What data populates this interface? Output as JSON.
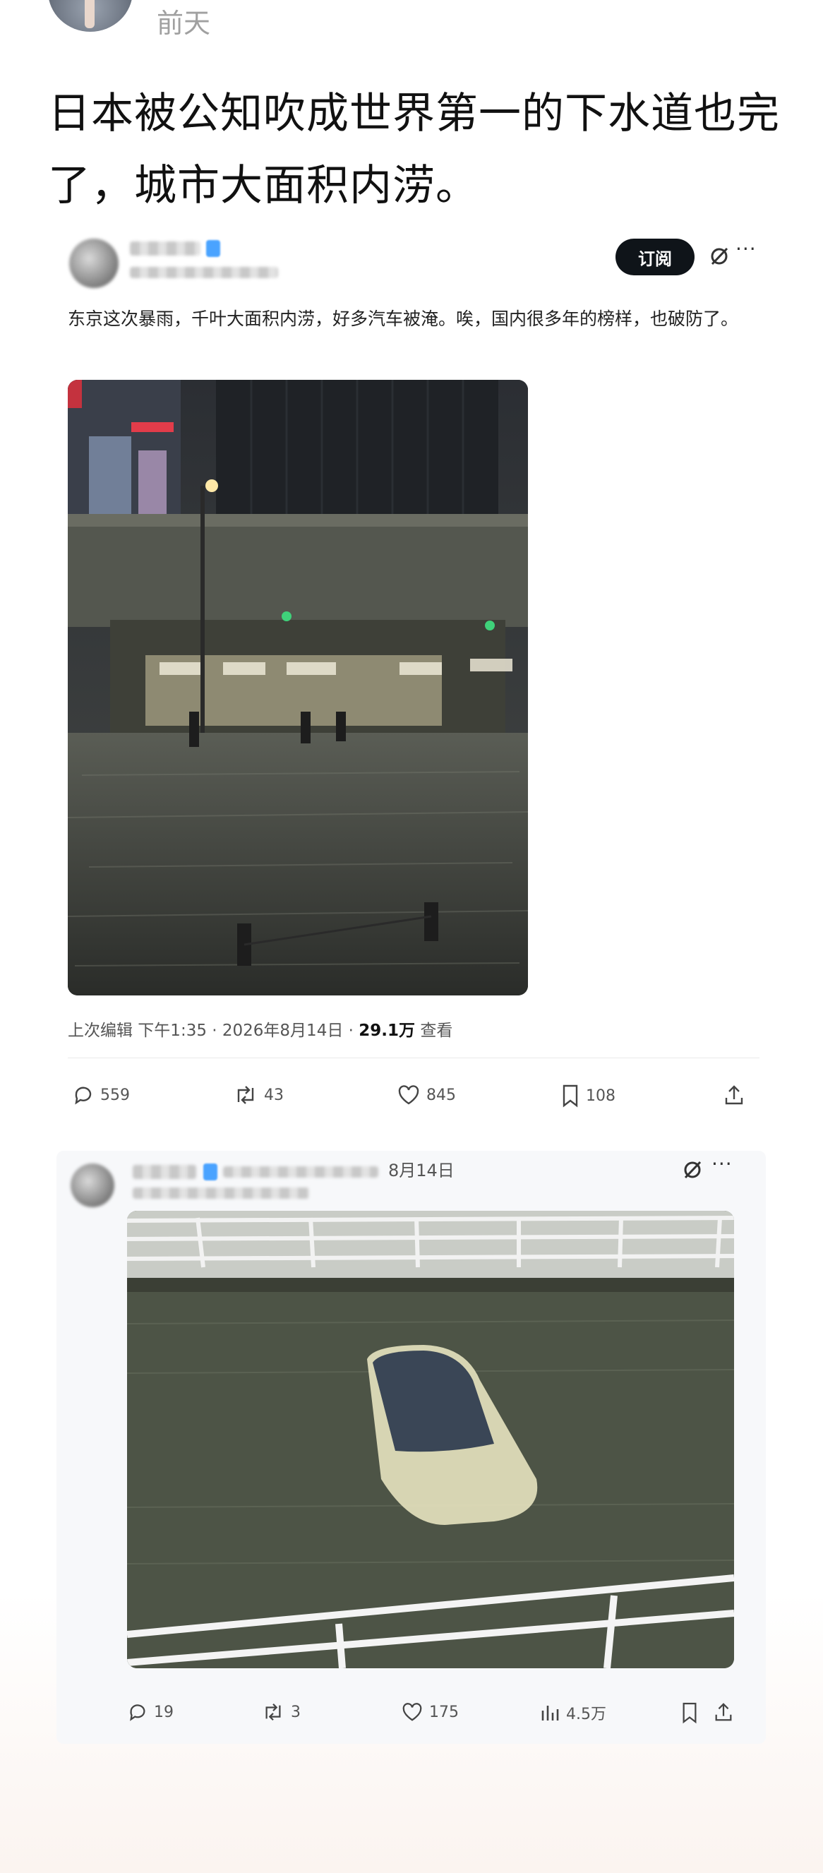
{
  "post": {
    "time": "前天",
    "headline": "日本被公知吹成世界第一的下水道也完了，城市大面积内涝。"
  },
  "tweet1": {
    "subscribe_label": "订阅",
    "text": "东京这次暴雨，千叶大面积内涝，好多汽车被淹。唉，国内很多年的榜样，也破防了。",
    "meta_prefix": "上次编辑 下午1:35 · 2026年8月14日 · ",
    "views": "29.1万",
    "views_suffix": " 查看",
    "actions": {
      "replies": "559",
      "retweets": "43",
      "likes": "845",
      "bookmarks": "108"
    }
  },
  "tweet2": {
    "date": "8月14日",
    "actions": {
      "replies": "19",
      "retweets": "3",
      "likes": "175",
      "views": "4.5万"
    }
  },
  "icons": [
    "grok-icon",
    "more-icon",
    "reply-icon",
    "retweet-icon",
    "like-icon",
    "bookmark-icon",
    "share-icon",
    "views-icon"
  ],
  "colors": {
    "subscribe_bg": "#0f1419",
    "badge_blue": "#4aa3ff",
    "meta_gray": "#555555"
  }
}
